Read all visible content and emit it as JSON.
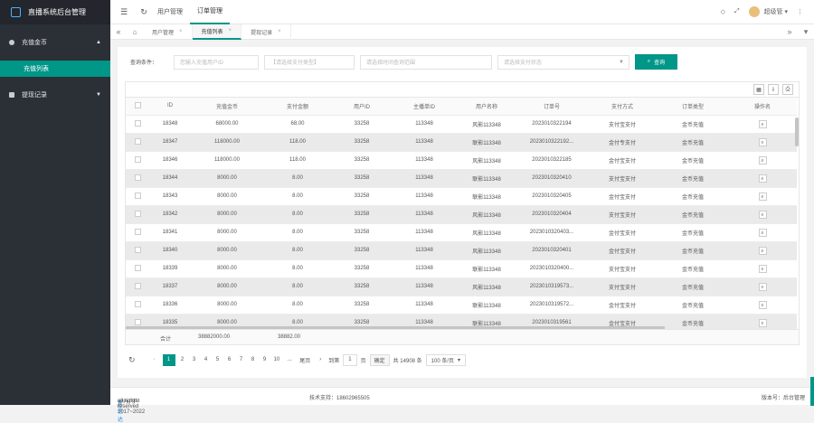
{
  "app": {
    "title": "直播系统后台管理"
  },
  "sidebar": {
    "items": [
      {
        "label": "充值金币",
        "expanded": true,
        "sub": [
          {
            "label": "充值列表"
          }
        ]
      },
      {
        "label": "提现记录",
        "expanded": false
      }
    ]
  },
  "topbar": {
    "tabs": [
      {
        "label": "用户管理"
      },
      {
        "label": "订单管理"
      }
    ],
    "user": "超级管"
  },
  "tabbar": {
    "tabs": [
      {
        "label": "用户管理"
      },
      {
        "label": "充值列表"
      },
      {
        "label": "提现记录"
      }
    ]
  },
  "filter": {
    "label": "查询条件：",
    "inputs": [
      {
        "placeholder": "您输入充值用户ID"
      },
      {
        "placeholder": "【请选择支付类型】"
      },
      {
        "placeholder": "请选择时间查询范围"
      },
      {
        "placeholder": "请选择支付状态"
      }
    ],
    "query_label": "查询"
  },
  "table": {
    "columns": [
      "ID",
      "充值金币",
      "支付金额",
      "用户ID",
      "主播单ID",
      "用户名称",
      "订单号",
      "支付方式",
      "订单类型",
      "操作名"
    ],
    "rows": [
      [
        "18348",
        "68000.00",
        "68.00",
        "33258",
        "113348",
        "风影113348",
        "2023010322194",
        "支付宝支付",
        "金币充值"
      ],
      [
        "18347",
        "118000.00",
        "118.00",
        "33258",
        "113348",
        "联影113348",
        "2023010322192...",
        "金付专支付",
        "金币充值"
      ],
      [
        "18346",
        "118000.00",
        "118.00",
        "33258",
        "113348",
        "风影113348",
        "2023010322185",
        "金付宝支付",
        "金币充值"
      ],
      [
        "18344",
        "8000.00",
        "8.00",
        "33258",
        "113348",
        "联影113348",
        "2023010320410",
        "支付宝支付",
        "金币充值"
      ],
      [
        "18343",
        "8000.00",
        "8.00",
        "33258",
        "113348",
        "联影113348",
        "2023010320405",
        "金付宝支付",
        "金币充值"
      ],
      [
        "18342",
        "8000.00",
        "8.00",
        "33258",
        "113348",
        "风影113348",
        "2023010320404",
        "支付宝支付",
        "金币充值"
      ],
      [
        "18341",
        "8000.00",
        "8.00",
        "33258",
        "113348",
        "风影113348",
        "2023010320403...",
        "金付宝支付",
        "金币充值"
      ],
      [
        "18340",
        "8000.00",
        "8.00",
        "33258",
        "113348",
        "风影113348",
        "2023010320401",
        "金付宝支付",
        "金币充值"
      ],
      [
        "18339",
        "8000.00",
        "8.00",
        "33258",
        "113348",
        "联影113348",
        "2023010320400...",
        "支付宝支付",
        "金币充值"
      ],
      [
        "18337",
        "8000.00",
        "8.00",
        "33258",
        "113348",
        "风影113348",
        "2023010319573...",
        "支付宝支付",
        "金币充值"
      ],
      [
        "18336",
        "8000.00",
        "8.00",
        "33258",
        "113348",
        "联影113348",
        "2023010319572...",
        "金付宝支付",
        "金币充值"
      ],
      [
        "18335",
        "8000.00",
        "8.00",
        "33258",
        "113348",
        "联影113348",
        "2023010319561",
        "金付宝支付",
        "金币充值"
      ]
    ],
    "total_label": "合计",
    "total_coins": "38882000.00",
    "total_amount": "38882.00"
  },
  "pager": {
    "pages": [
      "1",
      "2",
      "3",
      "4",
      "5",
      "6",
      "7",
      "8",
      "9",
      "10"
    ],
    "ellipsis": "...",
    "last_label": "尾页",
    "goto_label": "到第",
    "page_input": "1",
    "page_suffix": "页",
    "confirm_label": "确定",
    "total_text": "共 14908 条",
    "per_page": "100 条/页"
  },
  "footer": {
    "copyright_prefix": "copyright © 2017~2022",
    "brand": "东信达",
    "copyright_suffix": "all rights reserved",
    "support": "技术支持：18602965505",
    "version": "版本号：后台管理"
  },
  "colors": {
    "accent": "#009688",
    "sidebar_bg": "#2b2f36"
  }
}
